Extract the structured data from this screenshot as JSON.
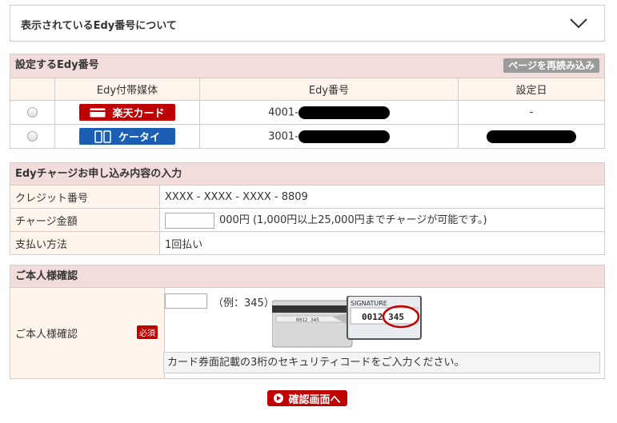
{
  "accordion": {
    "title": "表示されているEdy番号について"
  },
  "section1": {
    "title": "設定するEdy番号",
    "reload_label": "ページを再読み込み",
    "columns": [
      "Edy付帯媒体",
      "Edy番号",
      "設定日"
    ],
    "rows": [
      {
        "media": "楽天カード",
        "edy_prefix": "4001-",
        "date": "-"
      },
      {
        "media": "ケータイ",
        "edy_prefix": "3001-",
        "date": ""
      }
    ]
  },
  "section2": {
    "title": "Edyチャージお申し込み内容の入力",
    "rows": [
      {
        "label": "クレジット番号",
        "value": "XXXX - XXXX - XXXX - 8809"
      },
      {
        "label": "チャージ金額",
        "suffix": "000円 (1,000円以上25,000円までチャージが可能です。)"
      },
      {
        "label": "支払い方法",
        "value": "1回払い"
      }
    ]
  },
  "section3": {
    "title": "ご本人様確認",
    "label": "ご本人様確認",
    "required": "必須",
    "example": "（例：345）",
    "card_digits": "0012 345",
    "signature": "SIGNATURE",
    "hint": "カード券面記載の3桁のセキュリティコードをご入力ください。"
  },
  "confirm": {
    "label": "確認画面へ"
  },
  "colors": {
    "brand_red": "#bf0000",
    "header_pink": "#f3dcdc",
    "cell_beige": "#fff5ec",
    "badge_blue": "#1a5fb4"
  }
}
